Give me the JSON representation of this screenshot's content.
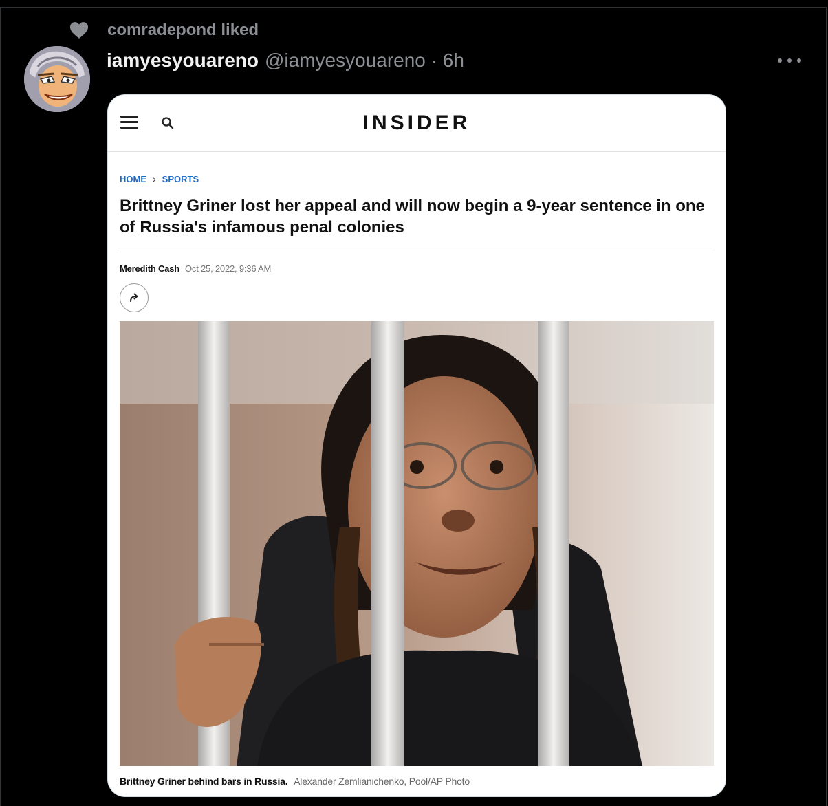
{
  "liked": {
    "text": "comradepond liked",
    "icon": "heart-icon"
  },
  "post": {
    "display_name": "iamyesyouareno",
    "handle": "@iamyesyouareno · 6h",
    "more_icon": "more-icon"
  },
  "article": {
    "logo": "INSIDER",
    "breadcrumb": {
      "home": "HOME",
      "section": "SPORTS"
    },
    "headline": "Brittney Griner lost her appeal and will now begin a 9-year sentence in one of Russia's infamous penal colonies",
    "author": "Meredith Cash",
    "date": "Oct 25, 2022, 9:36 AM",
    "caption": "Brittney Griner behind bars in Russia.",
    "credit": "Alexander Zemlianichenko, Pool/AP Photo"
  },
  "colors": {
    "background": "#000000",
    "muted": "#8b8f94",
    "link_blue": "#1e6ac7",
    "card": "#ffffff"
  }
}
